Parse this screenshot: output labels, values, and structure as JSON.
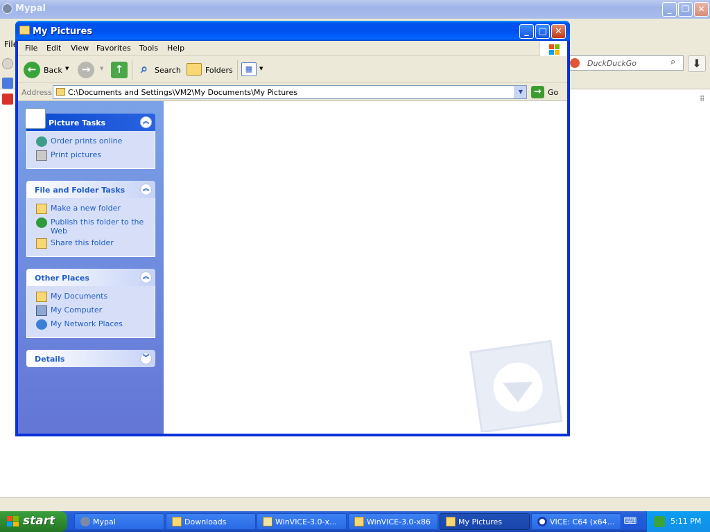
{
  "background_app": {
    "title": "Mypal",
    "file_menu": "File",
    "search_placeholder": "DuckDuckGo"
  },
  "window": {
    "title": "My Pictures",
    "menu": [
      "File",
      "Edit",
      "View",
      "Favorites",
      "Tools",
      "Help"
    ],
    "toolbar": {
      "back": "Back",
      "search": "Search",
      "folders": "Folders"
    },
    "address": {
      "label": "Address",
      "value": "C:\\Documents and Settings\\VM2\\My Documents\\My Pictures",
      "go": "Go"
    },
    "panels": {
      "picture_tasks": {
        "title": "Picture Tasks",
        "items": [
          "Order prints online",
          "Print pictures"
        ]
      },
      "file_folder_tasks": {
        "title": "File and Folder Tasks",
        "items": [
          "Make a new folder",
          "Publish this folder to the Web",
          "Share this folder"
        ]
      },
      "other_places": {
        "title": "Other Places",
        "items": [
          "My Documents",
          "My Computer",
          "My Network Places"
        ]
      },
      "details": {
        "title": "Details"
      }
    }
  },
  "taskbar": {
    "start": "start",
    "buttons": [
      "Mypal",
      "Downloads",
      "WinVICE-3.0-x…",
      "WinVICE-3.0-x86",
      "My Pictures",
      "VICE: C64 (x64…"
    ],
    "active": "My Pictures",
    "clock": "5:11 PM"
  },
  "colors": {
    "title_blue": "#0053ee",
    "taskpane_blue": "#7ba2e7",
    "link_blue": "#215dc6",
    "start_green": "#2f8c2f",
    "tray_blue": "#0c9df0"
  }
}
